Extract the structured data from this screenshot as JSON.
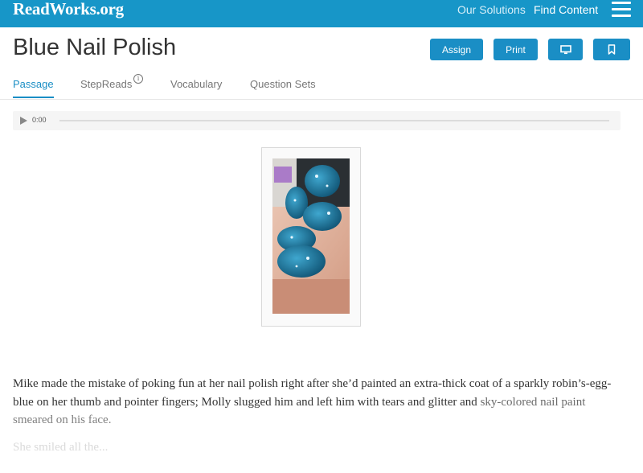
{
  "header": {
    "logo": "ReadWorks.org",
    "nav": [
      {
        "label": "Our Solutions"
      },
      {
        "label": "Find Content"
      }
    ]
  },
  "page": {
    "title": "Blue Nail Polish",
    "buttons": {
      "assign": "Assign",
      "print": "Print",
      "present_icon": "monitor-icon",
      "bookmark_icon": "bookmark-icon"
    }
  },
  "tabs": [
    {
      "label": "Passage",
      "active": true
    },
    {
      "label": "StepReads"
    },
    {
      "label": "Vocabulary"
    },
    {
      "label": "Question Sets"
    }
  ],
  "audio": {
    "time": "0:00"
  },
  "passage": {
    "paragraph1": "Mike made the mistake of poking fun at her nail polish right after she’d painted an extra-thick coat of a sparkly robin’s-egg-blue on her thumb and pointer fingers; Molly slugged him and left him with tears and glitter and",
    "paragraph1_tail": "sky-colored nail paint smeared on his face.",
    "paragraph2": "She smiled all the..."
  },
  "colors": {
    "brand": "#1796c8",
    "accent": "#1a8ec5"
  }
}
